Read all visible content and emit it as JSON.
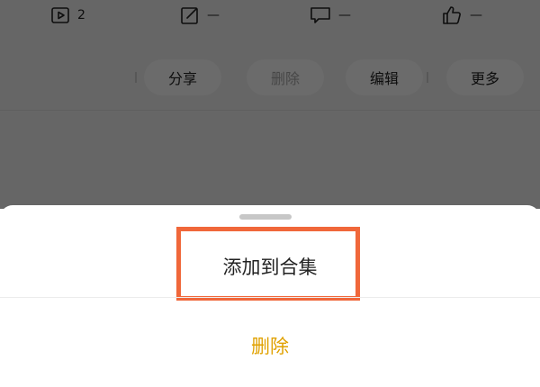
{
  "stats": {
    "plays": {
      "icon": "play-square-icon",
      "value": "2"
    },
    "edit": {
      "icon": "edit-square-icon",
      "value": "—"
    },
    "comment": {
      "icon": "comment-icon",
      "value": "—"
    },
    "like": {
      "icon": "thumbs-up-icon",
      "value": "—"
    }
  },
  "actions": {
    "share": "分享",
    "delete": "删除",
    "edit": "编辑",
    "more": "更多"
  },
  "sheet": {
    "add_to_collection": "添加到合集",
    "delete": "删除"
  },
  "colors": {
    "highlight_border": "#f0673a",
    "delete_text": "#e0a100",
    "overlay": "rgba(0,0,0,0.58)"
  }
}
